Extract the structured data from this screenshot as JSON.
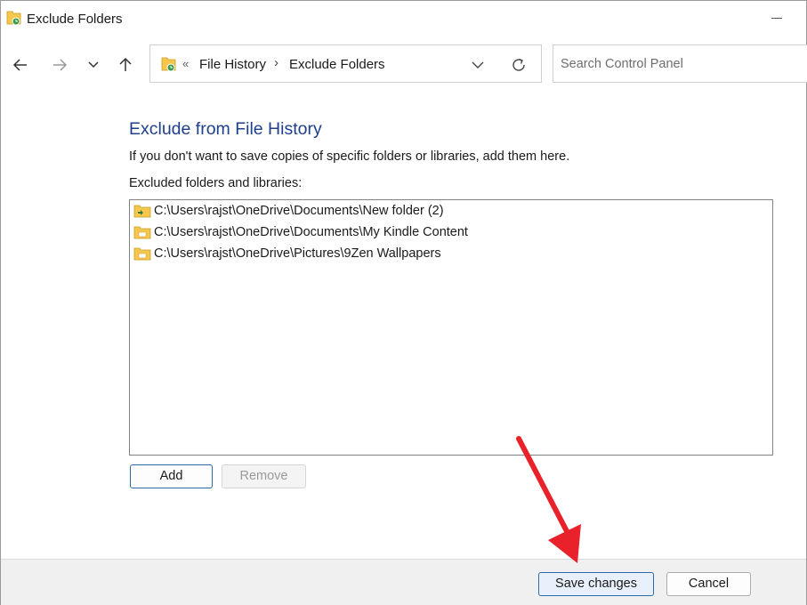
{
  "window": {
    "title": "Exclude Folders"
  },
  "nav": {
    "back_icon": "arrow-left-icon",
    "forward_icon": "arrow-right-icon",
    "recent_icon": "chevron-down-icon",
    "up_icon": "arrow-up-icon"
  },
  "address": {
    "overflow": "«",
    "crumbs": [
      "File History",
      "Exclude Folders"
    ],
    "separator": "›"
  },
  "search": {
    "placeholder": "Search Control Panel"
  },
  "content": {
    "heading": "Exclude from File History",
    "description": "If you don't want to save copies of specific folders or libraries, add them here.",
    "list_label": "Excluded folders and libraries:",
    "items": [
      "C:\\Users\\rajst\\OneDrive\\Documents\\New folder (2)",
      "C:\\Users\\rajst\\OneDrive\\Documents\\My Kindle Content",
      "C:\\Users\\rajst\\OneDrive\\Pictures\\9Zen Wallpapers"
    ],
    "add_label": "Add",
    "remove_label": "Remove"
  },
  "footer": {
    "save_label": "Save changes",
    "cancel_label": "Cancel"
  },
  "colors": {
    "heading": "#1e3f8c",
    "arrow": "#e8212a",
    "folder": "#f5c84c"
  }
}
